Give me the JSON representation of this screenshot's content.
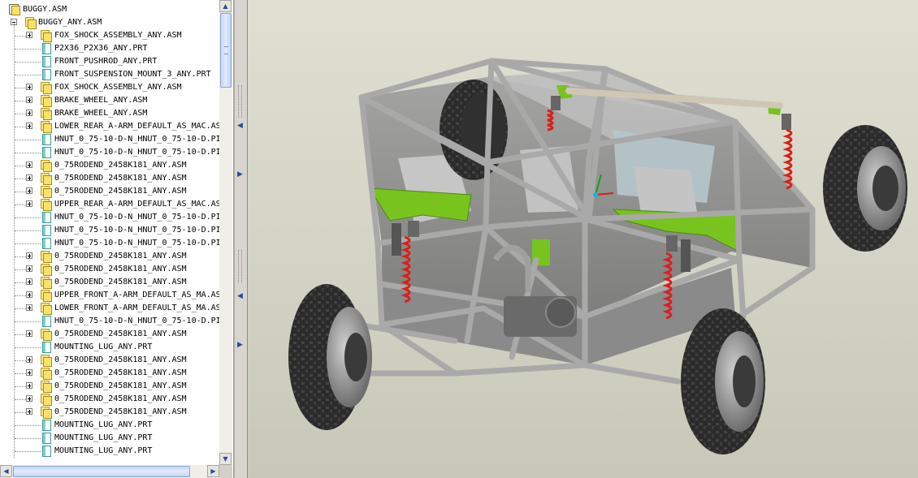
{
  "model_tree": {
    "root": "BUGGY.ASM",
    "assembly": "BUGGY_ANY.ASM",
    "items": [
      {
        "label": "FOX_SHOCK_ASSEMBLY_ANY.ASM",
        "type": "asm"
      },
      {
        "label": "P2X36_P2X36_ANY.PRT",
        "type": "prt"
      },
      {
        "label": "FRONT_PUSHROD_ANY.PRT",
        "type": "prt"
      },
      {
        "label": "FRONT_SUSPENSION_MOUNT_3_ANY.PRT",
        "type": "prt"
      },
      {
        "label": "FOX_SHOCK_ASSEMBLY_ANY.ASM",
        "type": "asm"
      },
      {
        "label": "BRAKE_WHEEL_ANY.ASM",
        "type": "asm"
      },
      {
        "label": "BRAKE_WHEEL_ANY.ASM",
        "type": "asm"
      },
      {
        "label": "LOWER_REAR_A-ARM_DEFAULT_AS_MAC.AS",
        "type": "asm"
      },
      {
        "label": "HNUT_0_75-10-D-N_HNUT_0_75-10-D.PI",
        "type": "prt"
      },
      {
        "label": "HNUT_0_75-10-D-N_HNUT_0_75-10-D.PI",
        "type": "prt"
      },
      {
        "label": "0_75RODEND_2458K181_ANY.ASM",
        "type": "asm"
      },
      {
        "label": "0_75RODEND_2458K181_ANY.ASM",
        "type": "asm"
      },
      {
        "label": "0_75RODEND_2458K181_ANY.ASM",
        "type": "asm"
      },
      {
        "label": "UPPER_REAR_A-ARM_DEFAULT_AS_MAC.AS",
        "type": "asm"
      },
      {
        "label": "HNUT_0_75-10-D-N_HNUT_0_75-10-D.PI",
        "type": "prt"
      },
      {
        "label": "HNUT_0_75-10-D-N_HNUT_0_75-10-D.PI",
        "type": "prt"
      },
      {
        "label": "HNUT_0_75-10-D-N_HNUT_0_75-10-D.PI",
        "type": "prt"
      },
      {
        "label": "0_75RODEND_2458K181_ANY.ASM",
        "type": "asm"
      },
      {
        "label": "0_75RODEND_2458K181_ANY.ASM",
        "type": "asm"
      },
      {
        "label": "0_75RODEND_2458K181_ANY.ASM",
        "type": "asm"
      },
      {
        "label": "UPPER_FRONT_A-ARM_DEFAULT_AS_MA.AS",
        "type": "asm"
      },
      {
        "label": "LOWER_FRONT_A-ARM_DEFAULT_AS_MA.AS",
        "type": "asm"
      },
      {
        "label": "HNUT_0_75-10-D-N_HNUT_0_75-10-D.PI",
        "type": "prt"
      },
      {
        "label": "0_75RODEND_2458K181_ANY.ASM",
        "type": "asm"
      },
      {
        "label": "MOUNTING_LUG_ANY.PRT",
        "type": "prt"
      },
      {
        "label": "0_75RODEND_2458K181_ANY.ASM",
        "type": "asm"
      },
      {
        "label": "0_75RODEND_2458K181_ANY.ASM",
        "type": "asm"
      },
      {
        "label": "0_75RODEND_2458K181_ANY.ASM",
        "type": "asm"
      },
      {
        "label": "0_75RODEND_2458K181_ANY.ASM",
        "type": "asm"
      },
      {
        "label": "0_75RODEND_2458K181_ANY.ASM",
        "type": "asm"
      },
      {
        "label": "MOUNTING_LUG_ANY.PRT",
        "type": "prt"
      },
      {
        "label": "MOUNTING_LUG_ANY.PRT",
        "type": "prt"
      },
      {
        "label": "MOUNTING_LUG_ANY.PRT",
        "type": "prt"
      }
    ]
  },
  "colors": {
    "frame_tube": "#a9a9a9",
    "body_panel": "#8c8c8c",
    "a_arm": "#79c31e",
    "spring": "#d8201a",
    "tire": "#2a2a2a",
    "viewport_bg": "#d5d6c8"
  },
  "icons": {
    "expand": "plus-box-icon",
    "collapse": "minus-box-icon",
    "assembly": "assembly-icon",
    "part": "part-icon"
  }
}
